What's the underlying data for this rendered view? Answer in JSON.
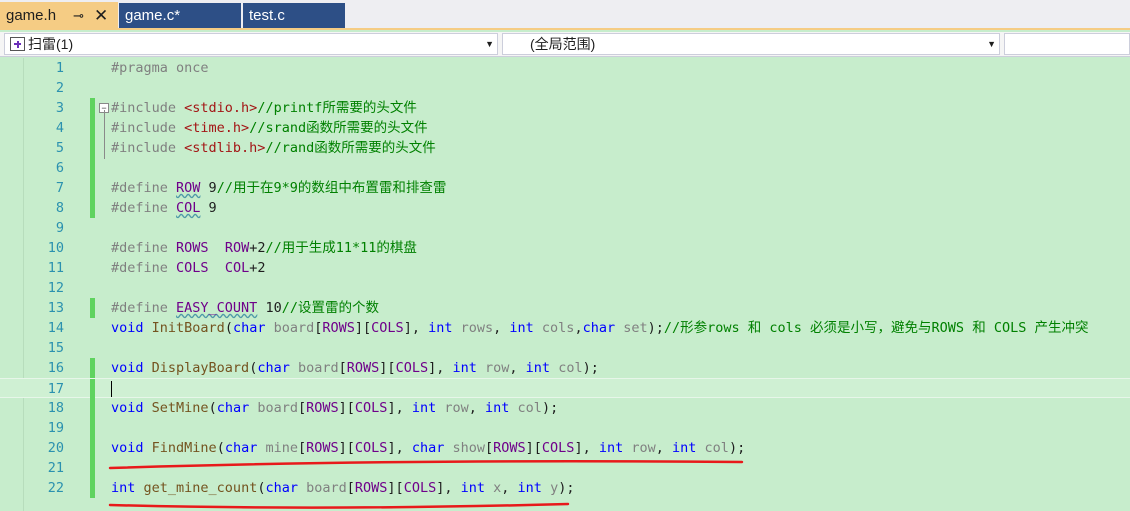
{
  "tabs": [
    {
      "label": "game.h",
      "pin": "⊸",
      "close": "✕"
    },
    {
      "label": "game.c*"
    },
    {
      "label": "test.c"
    }
  ],
  "nav": {
    "project": "扫雷(1)",
    "scope": "(全局范围)",
    "member": ""
  },
  "colors": {
    "editor_bg": "#c7edcc",
    "active_tab": "#f5cc84",
    "inactive_tab": "#2d4f86",
    "change_marker": "#5fd35f",
    "annotation": "#e8191b"
  },
  "editor": {
    "current_line": 17,
    "lines": [
      {
        "n": "1",
        "tokens": [
          {
            "t": "#pragma once",
            "c": "pp"
          }
        ]
      },
      {
        "n": "2",
        "tokens": []
      },
      {
        "n": "3",
        "fold": "−",
        "tokens": [
          {
            "t": "#include ",
            "c": "pp"
          },
          {
            "t": "<stdio.h>",
            "c": "inc"
          },
          {
            "t": "//printf所需要的头文件",
            "c": "cmt"
          }
        ]
      },
      {
        "n": "4",
        "tokens": [
          {
            "t": "#include ",
            "c": "pp"
          },
          {
            "t": "<time.h>",
            "c": "inc"
          },
          {
            "t": "//srand函数所需要的头文件",
            "c": "cmt"
          }
        ]
      },
      {
        "n": "5",
        "tokens": [
          {
            "t": "#include ",
            "c": "pp"
          },
          {
            "t": "<stdlib.h>",
            "c": "inc"
          },
          {
            "t": "//rand函数所需要的头文件",
            "c": "cmt"
          }
        ]
      },
      {
        "n": "6",
        "tokens": []
      },
      {
        "n": "7",
        "tokens": [
          {
            "t": "#define ",
            "c": "pp"
          },
          {
            "t": "ROW",
            "c": "mac sq"
          },
          {
            "t": " 9",
            "c": "num"
          },
          {
            "t": "//用于在9*9的数组中布置雷和排查雷",
            "c": "cmt"
          }
        ]
      },
      {
        "n": "8",
        "tokens": [
          {
            "t": "#define ",
            "c": "pp"
          },
          {
            "t": "COL",
            "c": "mac sq"
          },
          {
            "t": " 9",
            "c": "num"
          }
        ]
      },
      {
        "n": "9",
        "tokens": []
      },
      {
        "n": "10",
        "tokens": [
          {
            "t": "#define ",
            "c": "pp"
          },
          {
            "t": "ROWS",
            "c": "mac"
          },
          {
            "t": "  ",
            "c": ""
          },
          {
            "t": "ROW",
            "c": "mac"
          },
          {
            "t": "+2",
            "c": "num"
          },
          {
            "t": "//用于生成11*11的棋盘",
            "c": "cmt"
          }
        ]
      },
      {
        "n": "11",
        "tokens": [
          {
            "t": "#define ",
            "c": "pp"
          },
          {
            "t": "COLS",
            "c": "mac"
          },
          {
            "t": "  ",
            "c": ""
          },
          {
            "t": "COL",
            "c": "mac"
          },
          {
            "t": "+2",
            "c": "num"
          }
        ]
      },
      {
        "n": "12",
        "tokens": []
      },
      {
        "n": "13",
        "tokens": [
          {
            "t": "#define ",
            "c": "pp"
          },
          {
            "t": "EASY_COUNT",
            "c": "mac sq"
          },
          {
            "t": " 10",
            "c": "num"
          },
          {
            "t": "//设置雷的个数",
            "c": "cmt"
          }
        ]
      },
      {
        "n": "14",
        "tokens": [
          {
            "t": "void",
            "c": "kw"
          },
          {
            "t": " ",
            "c": ""
          },
          {
            "t": "InitBoard",
            "c": "fn"
          },
          {
            "t": "(",
            "c": ""
          },
          {
            "t": "char",
            "c": "kw"
          },
          {
            "t": " ",
            "c": ""
          },
          {
            "t": "board",
            "c": "prm"
          },
          {
            "t": "[",
            "c": ""
          },
          {
            "t": "ROWS",
            "c": "mac"
          },
          {
            "t": "][",
            "c": ""
          },
          {
            "t": "COLS",
            "c": "mac"
          },
          {
            "t": "], ",
            "c": ""
          },
          {
            "t": "int",
            "c": "kw"
          },
          {
            "t": " ",
            "c": ""
          },
          {
            "t": "rows",
            "c": "prm"
          },
          {
            "t": ", ",
            "c": ""
          },
          {
            "t": "int",
            "c": "kw"
          },
          {
            "t": " ",
            "c": ""
          },
          {
            "t": "cols",
            "c": "prm"
          },
          {
            "t": ",",
            "c": ""
          },
          {
            "t": "char",
            "c": "kw"
          },
          {
            "t": " ",
            "c": ""
          },
          {
            "t": "set",
            "c": "prm"
          },
          {
            "t": ");",
            "c": ""
          },
          {
            "t": "//形参rows 和 cols 必须是小写，避免与ROWS 和 COLS 产生冲突",
            "c": "cmt"
          }
        ]
      },
      {
        "n": "15",
        "tokens": []
      },
      {
        "n": "16",
        "tokens": [
          {
            "t": "void",
            "c": "kw"
          },
          {
            "t": " ",
            "c": ""
          },
          {
            "t": "DisplayBoard",
            "c": "fn"
          },
          {
            "t": "(",
            "c": ""
          },
          {
            "t": "char",
            "c": "kw"
          },
          {
            "t": " ",
            "c": ""
          },
          {
            "t": "board",
            "c": "prm"
          },
          {
            "t": "[",
            "c": ""
          },
          {
            "t": "ROWS",
            "c": "mac"
          },
          {
            "t": "][",
            "c": ""
          },
          {
            "t": "COLS",
            "c": "mac"
          },
          {
            "t": "], ",
            "c": ""
          },
          {
            "t": "int",
            "c": "kw"
          },
          {
            "t": " ",
            "c": ""
          },
          {
            "t": "row",
            "c": "prm"
          },
          {
            "t": ", ",
            "c": ""
          },
          {
            "t": "int",
            "c": "kw"
          },
          {
            "t": " ",
            "c": ""
          },
          {
            "t": "col",
            "c": "prm"
          },
          {
            "t": ");",
            "c": ""
          }
        ]
      },
      {
        "n": "17",
        "tokens": []
      },
      {
        "n": "18",
        "tokens": [
          {
            "t": "void",
            "c": "kw"
          },
          {
            "t": " ",
            "c": ""
          },
          {
            "t": "SetMine",
            "c": "fn"
          },
          {
            "t": "(",
            "c": ""
          },
          {
            "t": "char",
            "c": "kw"
          },
          {
            "t": " ",
            "c": ""
          },
          {
            "t": "board",
            "c": "prm"
          },
          {
            "t": "[",
            "c": ""
          },
          {
            "t": "ROWS",
            "c": "mac"
          },
          {
            "t": "][",
            "c": ""
          },
          {
            "t": "COLS",
            "c": "mac"
          },
          {
            "t": "], ",
            "c": ""
          },
          {
            "t": "int",
            "c": "kw"
          },
          {
            "t": " ",
            "c": ""
          },
          {
            "t": "row",
            "c": "prm"
          },
          {
            "t": ", ",
            "c": ""
          },
          {
            "t": "int",
            "c": "kw"
          },
          {
            "t": " ",
            "c": ""
          },
          {
            "t": "col",
            "c": "prm"
          },
          {
            "t": ");",
            "c": ""
          }
        ]
      },
      {
        "n": "19",
        "tokens": []
      },
      {
        "n": "20",
        "tokens": [
          {
            "t": "void",
            "c": "kw"
          },
          {
            "t": " ",
            "c": ""
          },
          {
            "t": "FindMine",
            "c": "fn"
          },
          {
            "t": "(",
            "c": ""
          },
          {
            "t": "char",
            "c": "kw"
          },
          {
            "t": " ",
            "c": ""
          },
          {
            "t": "mine",
            "c": "prm"
          },
          {
            "t": "[",
            "c": ""
          },
          {
            "t": "ROWS",
            "c": "mac"
          },
          {
            "t": "][",
            "c": ""
          },
          {
            "t": "COLS",
            "c": "mac"
          },
          {
            "t": "], ",
            "c": ""
          },
          {
            "t": "char",
            "c": "kw"
          },
          {
            "t": " ",
            "c": ""
          },
          {
            "t": "show",
            "c": "prm"
          },
          {
            "t": "[",
            "c": ""
          },
          {
            "t": "ROWS",
            "c": "mac"
          },
          {
            "t": "][",
            "c": ""
          },
          {
            "t": "COLS",
            "c": "mac"
          },
          {
            "t": "], ",
            "c": ""
          },
          {
            "t": "int",
            "c": "kw"
          },
          {
            "t": " ",
            "c": ""
          },
          {
            "t": "row",
            "c": "prm"
          },
          {
            "t": ", ",
            "c": ""
          },
          {
            "t": "int",
            "c": "kw"
          },
          {
            "t": " ",
            "c": ""
          },
          {
            "t": "col",
            "c": "prm"
          },
          {
            "t": ");",
            "c": ""
          }
        ]
      },
      {
        "n": "21",
        "tokens": []
      },
      {
        "n": "22",
        "tokens": [
          {
            "t": "int",
            "c": "kw"
          },
          {
            "t": " ",
            "c": ""
          },
          {
            "t": "get_mine_count",
            "c": "fn"
          },
          {
            "t": "(",
            "c": ""
          },
          {
            "t": "char",
            "c": "kw"
          },
          {
            "t": " ",
            "c": ""
          },
          {
            "t": "board",
            "c": "prm"
          },
          {
            "t": "[",
            "c": ""
          },
          {
            "t": "ROWS",
            "c": "mac"
          },
          {
            "t": "][",
            "c": ""
          },
          {
            "t": "COLS",
            "c": "mac"
          },
          {
            "t": "], ",
            "c": ""
          },
          {
            "t": "int",
            "c": "kw"
          },
          {
            "t": " ",
            "c": ""
          },
          {
            "t": "x",
            "c": "prm"
          },
          {
            "t": ", ",
            "c": ""
          },
          {
            "t": "int",
            "c": "kw"
          },
          {
            "t": " ",
            "c": ""
          },
          {
            "t": "y",
            "c": "prm"
          },
          {
            "t": ");",
            "c": ""
          }
        ]
      }
    ]
  }
}
